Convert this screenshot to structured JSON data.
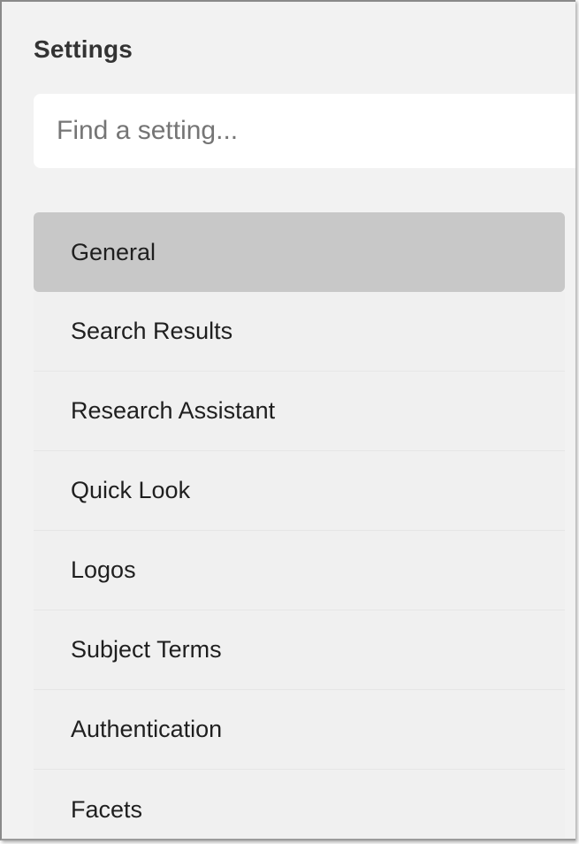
{
  "header": {
    "title": "Settings"
  },
  "search": {
    "placeholder": "Find a setting...",
    "value": ""
  },
  "menu": {
    "active_index": 0,
    "items": [
      {
        "label": "General"
      },
      {
        "label": "Search Results"
      },
      {
        "label": "Research Assistant"
      },
      {
        "label": "Quick Look"
      },
      {
        "label": "Logos"
      },
      {
        "label": "Subject Terms"
      },
      {
        "label": "Authentication"
      },
      {
        "label": "Facets"
      }
    ]
  },
  "colors": {
    "panel_background": "#f2f2f2",
    "active_item_background": "#c8c8c8",
    "item_background": "#f0f0f0",
    "search_background": "#ffffff",
    "text": "#1f1f1f",
    "placeholder_text": "#757575"
  }
}
